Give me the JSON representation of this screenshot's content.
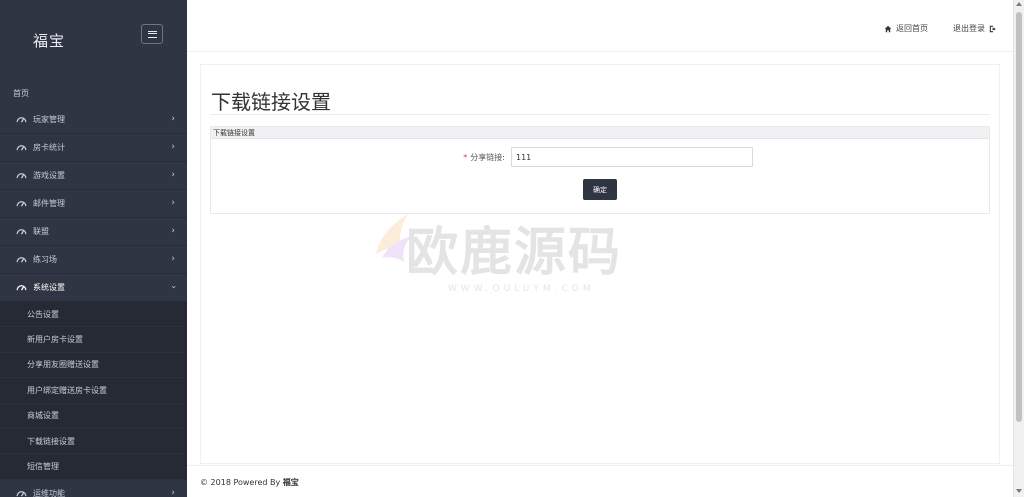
{
  "sidebar": {
    "brand": "福宝",
    "home_label": "首页",
    "items": [
      {
        "label": "玩家管理"
      },
      {
        "label": "房卡统计"
      },
      {
        "label": "游戏设置"
      },
      {
        "label": "邮件管理"
      },
      {
        "label": "联盟"
      },
      {
        "label": "练习场"
      },
      {
        "label": "系统设置"
      }
    ],
    "subitems": [
      {
        "label": "公告设置"
      },
      {
        "label": "新用户房卡设置"
      },
      {
        "label": "分享朋友圈赠送设置"
      },
      {
        "label": "用户绑定赠送房卡设置"
      },
      {
        "label": "商城设置"
      },
      {
        "label": "下载链接设置"
      },
      {
        "label": "短信管理"
      }
    ],
    "last_item": "运维功能"
  },
  "topbar": {
    "home_link": "返回首页",
    "logout_link": "退出登录"
  },
  "page": {
    "title": "下载链接设置",
    "panel_title": "下载链接设置",
    "field_label": "分享链接:",
    "field_required": "*",
    "field_value": "111",
    "confirm": "确定"
  },
  "watermark": {
    "text": "欧鹿源码",
    "url": "WWW.OULUYM.COM"
  },
  "footer": {
    "prefix": "© 2018 Powered By ",
    "brand": "福宝"
  },
  "colors": {
    "sidebar_bg": "#2f3542",
    "button_bg": "#2f3542",
    "required": "#e53935"
  }
}
